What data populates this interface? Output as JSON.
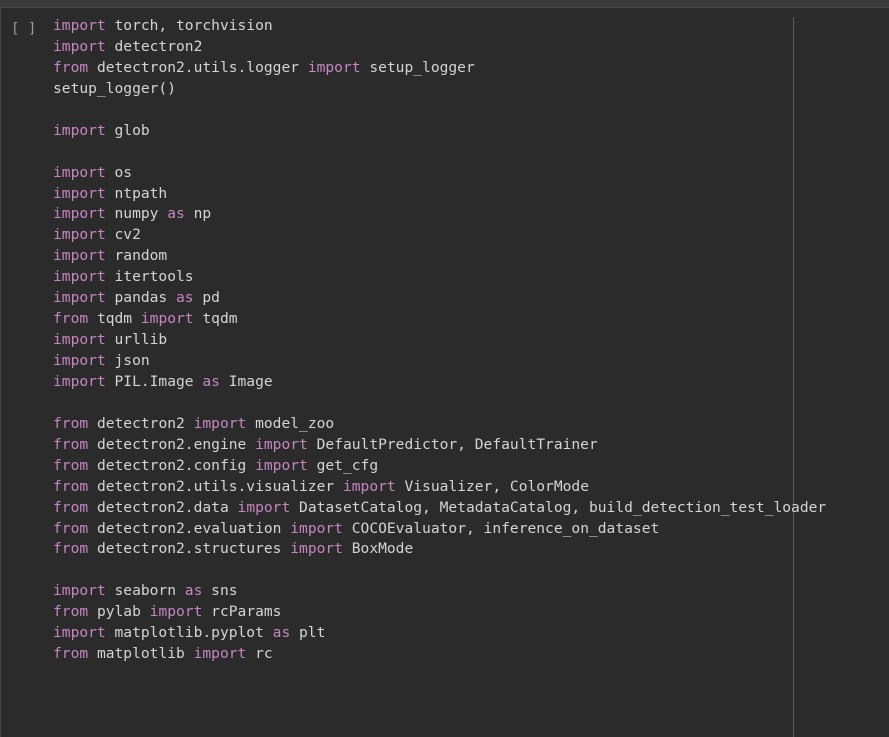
{
  "cell": {
    "run_indicator": "[ ]",
    "lines": [
      [
        {
          "k": "import"
        },
        {
          "t": " torch, torchvision"
        }
      ],
      [
        {
          "k": "import"
        },
        {
          "t": " detectron2"
        }
      ],
      [
        {
          "k": "from"
        },
        {
          "t": " detectron2.utils.logger "
        },
        {
          "k": "import"
        },
        {
          "t": " setup_logger"
        }
      ],
      [
        {
          "t": "setup_logger()"
        }
      ],
      [],
      [
        {
          "k": "import"
        },
        {
          "t": " glob"
        }
      ],
      [],
      [
        {
          "k": "import"
        },
        {
          "t": " os"
        }
      ],
      [
        {
          "k": "import"
        },
        {
          "t": " ntpath"
        }
      ],
      [
        {
          "k": "import"
        },
        {
          "t": " numpy "
        },
        {
          "k": "as"
        },
        {
          "t": " np"
        }
      ],
      [
        {
          "k": "import"
        },
        {
          "t": " cv2"
        }
      ],
      [
        {
          "k": "import"
        },
        {
          "t": " random"
        }
      ],
      [
        {
          "k": "import"
        },
        {
          "t": " itertools"
        }
      ],
      [
        {
          "k": "import"
        },
        {
          "t": " pandas "
        },
        {
          "k": "as"
        },
        {
          "t": " pd"
        }
      ],
      [
        {
          "k": "from"
        },
        {
          "t": " tqdm "
        },
        {
          "k": "import"
        },
        {
          "t": " tqdm"
        }
      ],
      [
        {
          "k": "import"
        },
        {
          "t": " urllib"
        }
      ],
      [
        {
          "k": "import"
        },
        {
          "t": " json"
        }
      ],
      [
        {
          "k": "import"
        },
        {
          "t": " PIL.Image "
        },
        {
          "k": "as"
        },
        {
          "t": " Image"
        }
      ],
      [],
      [
        {
          "k": "from"
        },
        {
          "t": " detectron2 "
        },
        {
          "k": "import"
        },
        {
          "t": " model_zoo"
        }
      ],
      [
        {
          "k": "from"
        },
        {
          "t": " detectron2.engine "
        },
        {
          "k": "import"
        },
        {
          "t": " DefaultPredictor, DefaultTrainer"
        }
      ],
      [
        {
          "k": "from"
        },
        {
          "t": " detectron2.config "
        },
        {
          "k": "import"
        },
        {
          "t": " get_cfg"
        }
      ],
      [
        {
          "k": "from"
        },
        {
          "t": " detectron2.utils.visualizer "
        },
        {
          "k": "import"
        },
        {
          "t": " Visualizer, ColorMode"
        }
      ],
      [
        {
          "k": "from"
        },
        {
          "t": " detectron2.data "
        },
        {
          "k": "import"
        },
        {
          "t": " DatasetCatalog, MetadataCatalog, build_detection_test_loader"
        }
      ],
      [
        {
          "k": "from"
        },
        {
          "t": " detectron2.evaluation "
        },
        {
          "k": "import"
        },
        {
          "t": " COCOEvaluator, inference_on_dataset"
        }
      ],
      [
        {
          "k": "from"
        },
        {
          "t": " detectron2.structures "
        },
        {
          "k": "import"
        },
        {
          "t": " BoxMode"
        }
      ],
      [],
      [
        {
          "k": "import"
        },
        {
          "t": " seaborn "
        },
        {
          "k": "as"
        },
        {
          "t": " sns"
        }
      ],
      [
        {
          "k": "from"
        },
        {
          "t": " pylab "
        },
        {
          "k": "import"
        },
        {
          "t": " rcParams"
        }
      ],
      [
        {
          "k": "import"
        },
        {
          "t": " matplotlib.pyplot "
        },
        {
          "k": "as"
        },
        {
          "t": " plt"
        }
      ],
      [
        {
          "k": "from"
        },
        {
          "t": " matplotlib "
        },
        {
          "k": "import"
        },
        {
          "t": " rc"
        }
      ]
    ]
  },
  "colors": {
    "background": "#2b2b2b",
    "keyword": "#c586c0",
    "text": "#d4d4d4",
    "indicator": "#9a9a9a"
  }
}
